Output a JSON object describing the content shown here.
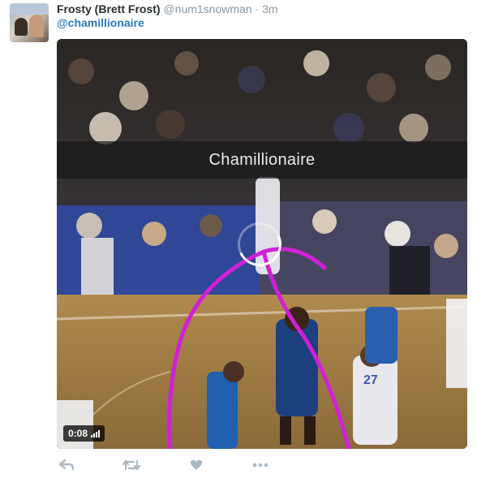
{
  "tweet": {
    "display_name": "Frosty (Brett Frost)",
    "handle": "@num1snowman",
    "separator": "·",
    "time": "3m",
    "text": "@chamillionaire"
  },
  "media": {
    "caption": "Chamillionaire",
    "duration": "0:08",
    "jersey_numbers": [
      "27"
    ]
  },
  "actions": {
    "reply_icon": "reply-icon",
    "retweet_icon": "retweet-icon",
    "like_icon": "heart-icon",
    "more_icon": "more-icon"
  },
  "colors": {
    "accent": "#2b7bb9",
    "annotation": "#d21fd8",
    "icon": "#aab8c2"
  }
}
